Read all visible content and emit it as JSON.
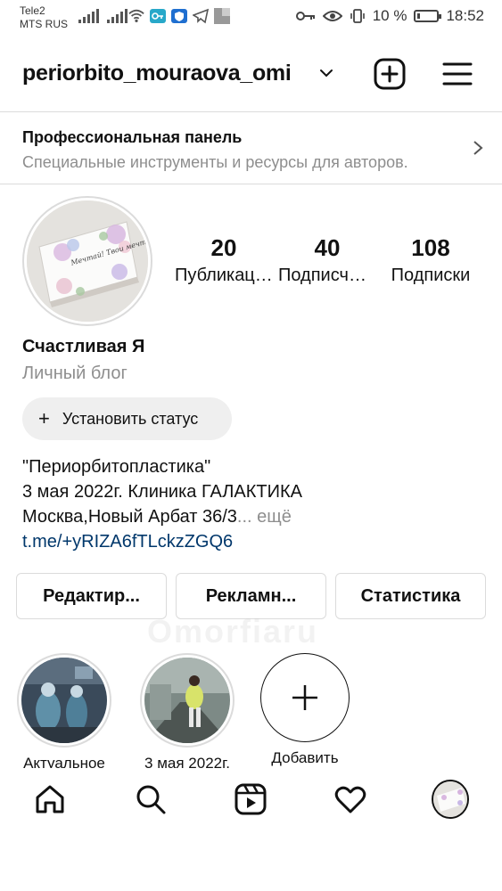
{
  "status_bar": {
    "carrier_1": "Tele2",
    "carrier_2": "MTS RUS",
    "battery": "10 %",
    "time": "18:52"
  },
  "header": {
    "username": "periorbito_mouraova_omi"
  },
  "pro_panel": {
    "title": "Профессиональная панель",
    "subtitle": "Специальные инструменты и ресурсы для авторов."
  },
  "profile": {
    "avatar_text": "Мечтай! Твои мечты обязательно сбудутся",
    "stats": [
      {
        "value": "20",
        "label": "Публикации"
      },
      {
        "value": "40",
        "label": "Подписчики"
      },
      {
        "value": "108",
        "label": "Подписки"
      }
    ],
    "name": "Счастливая Я",
    "category": "Личный блог",
    "status_button": "Установить статус",
    "bio_lines": [
      "\"Периорбитопластика\"",
      "3 мая 2022г. Клиника ГАЛАКТИКА",
      "Москва,Новый Арбат 36/3"
    ],
    "bio_more": "... ещё",
    "link": "t.me/+yRIZA6fTLckzZGQ6"
  },
  "actions": {
    "edit": "Редактир...",
    "ads": "Рекламн...",
    "stats": "Статистика"
  },
  "watermark": "Omorfiaru",
  "highlights": [
    {
      "label": "Актуальное"
    },
    {
      "label": "3 мая 2022г."
    },
    {
      "label": "Добавить"
    }
  ],
  "colors": {
    "link": "#00376b",
    "secondary_text": "#8e8e8e",
    "divider": "#dbdbdb",
    "button_bg": "#efefef"
  }
}
